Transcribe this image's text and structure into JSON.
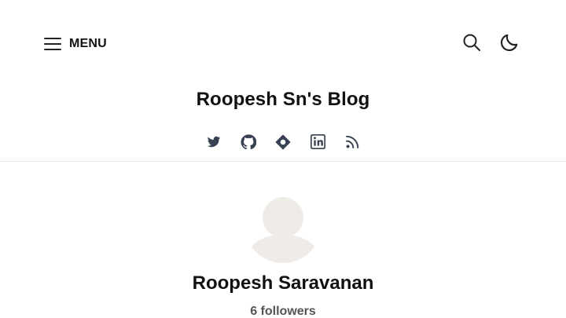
{
  "header": {
    "menu_label": "MENU",
    "menu_icon": "hamburger-icon",
    "search_icon": "search-icon",
    "theme_icon": "moon-icon"
  },
  "blog": {
    "title": "Roopesh Sn's Blog"
  },
  "social": [
    {
      "name": "Twitter",
      "icon": "twitter-icon"
    },
    {
      "name": "GitHub",
      "icon": "github-icon"
    },
    {
      "name": "Website",
      "icon": "website-icon"
    },
    {
      "name": "LinkedIn",
      "icon": "linkedin-icon"
    },
    {
      "name": "RSS",
      "icon": "rss-icon"
    }
  ],
  "author": {
    "name": "Roopesh Saravanan",
    "followers": "6 followers",
    "avatar_icon": "default-avatar-icon"
  },
  "colors": {
    "text": "#111111",
    "muted": "#555555",
    "icon": "#374151",
    "divider": "#e5e7eb",
    "avatar_placeholder": "#efece8"
  }
}
